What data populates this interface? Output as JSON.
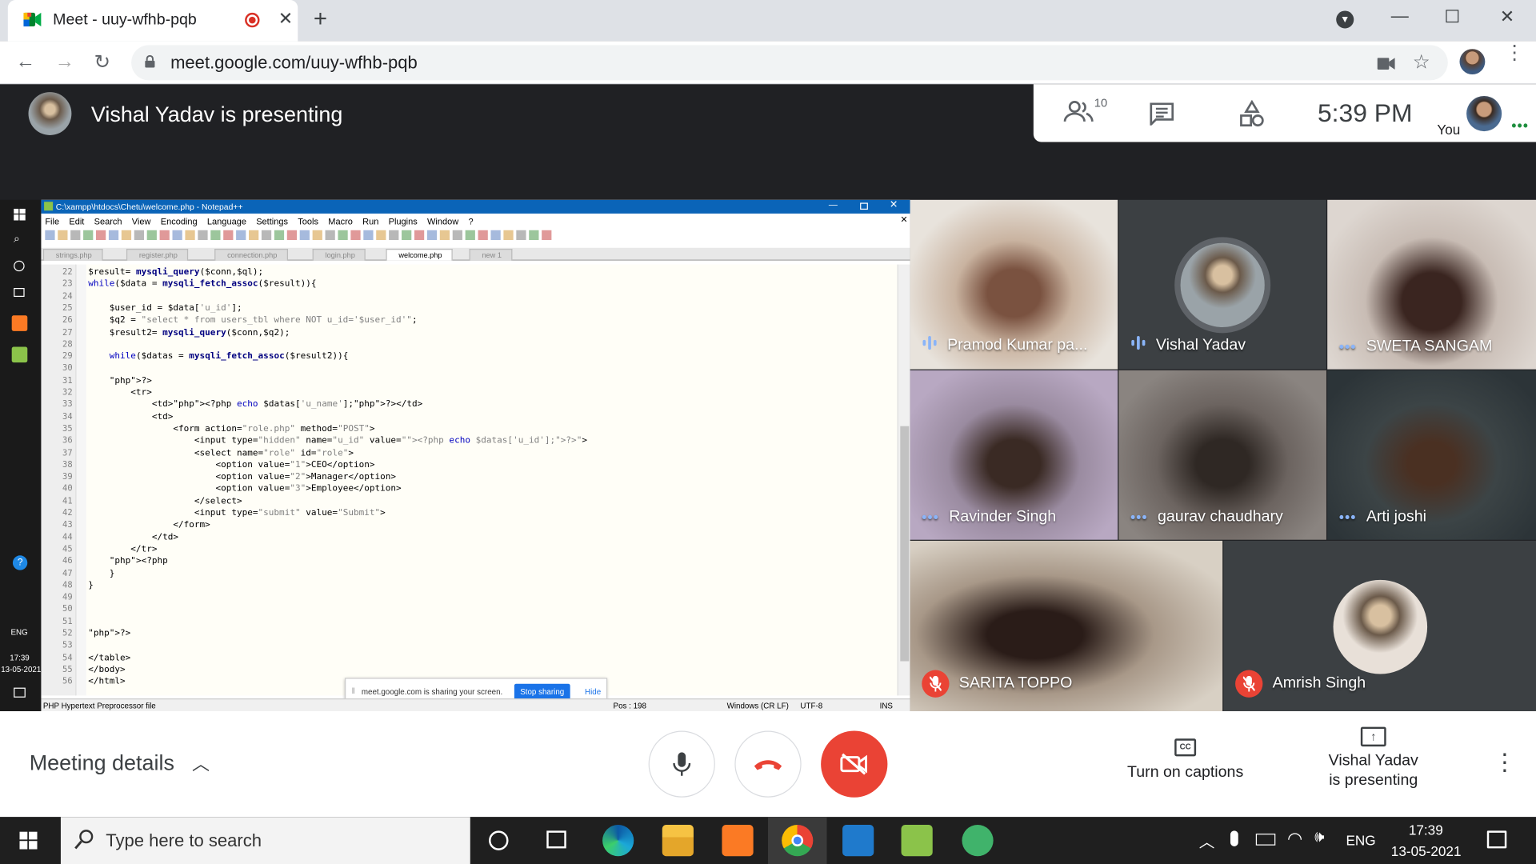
{
  "browser": {
    "tab_title": "Meet - uuy-wfhb-pqb",
    "url": "meet.google.com/uuy-wfhb-pqb"
  },
  "meet": {
    "presenting_label": "Vishal Yadav is presenting",
    "participants_count": "10",
    "time": "5:39 PM",
    "you_label": "You"
  },
  "notepad": {
    "title": "C:\\xampp\\htdocs\\Chetu\\welcome.php - Notepad++",
    "menu": [
      "File",
      "Edit",
      "Search",
      "View",
      "Encoding",
      "Language",
      "Settings",
      "Tools",
      "Macro",
      "Run",
      "Plugins",
      "Window",
      "?"
    ],
    "tabs": [
      "strings.php",
      "register.php",
      "connection.php",
      "login.php",
      "welcome.php",
      "new 1"
    ],
    "active_tab": "welcome.php",
    "lines": [
      {
        "n": "22",
        "t": "$result= mysqli_query($conn,$ql);"
      },
      {
        "n": "23",
        "t": "while($data = mysqli_fetch_assoc($result)){"
      },
      {
        "n": "24",
        "t": ""
      },
      {
        "n": "25",
        "t": "    $user_id = $data['u_id'];"
      },
      {
        "n": "26",
        "t": "    $q2 = \"select * from users_tbl where NOT u_id='$user_id'\";"
      },
      {
        "n": "27",
        "t": "    $result2= mysqli_query($conn,$q2);"
      },
      {
        "n": "28",
        "t": ""
      },
      {
        "n": "29",
        "t": "    while($datas = mysqli_fetch_assoc($result2)){"
      },
      {
        "n": "30",
        "t": ""
      },
      {
        "n": "31",
        "t": "    ?>"
      },
      {
        "n": "32",
        "t": "        <tr>"
      },
      {
        "n": "33",
        "t": "            <td><?php echo $datas['u_name'];?></td>"
      },
      {
        "n": "34",
        "t": "            <td>"
      },
      {
        "n": "35",
        "t": "                <form action=\"role.php\" method=\"POST\">"
      },
      {
        "n": "36",
        "t": "                    <input type=\"hidden\" name=\"u_id\" value=\"<?php echo $datas['u_id'];?>\">"
      },
      {
        "n": "37",
        "t": "                    <select name=\"role\" id=\"role\">"
      },
      {
        "n": "38",
        "t": "                        <option value=\"1\">CEO</option>"
      },
      {
        "n": "39",
        "t": "                        <option value=\"2\">Manager</option>"
      },
      {
        "n": "40",
        "t": "                        <option value=\"3\">Employee</option>"
      },
      {
        "n": "41",
        "t": "                    </select>"
      },
      {
        "n": "42",
        "t": "                    <input type=\"submit\" value=\"Submit\">"
      },
      {
        "n": "43",
        "t": "                </form>"
      },
      {
        "n": "44",
        "t": "            </td>"
      },
      {
        "n": "45",
        "t": "        </tr>"
      },
      {
        "n": "46",
        "t": "    <?php"
      },
      {
        "n": "47",
        "t": "    }"
      },
      {
        "n": "48",
        "t": "}"
      },
      {
        "n": "49",
        "t": ""
      },
      {
        "n": "50",
        "t": ""
      },
      {
        "n": "51",
        "t": ""
      },
      {
        "n": "52",
        "t": "?>"
      },
      {
        "n": "53",
        "t": ""
      },
      {
        "n": "54",
        "t": "</table>"
      },
      {
        "n": "55",
        "t": "</body>"
      },
      {
        "n": "56",
        "t": "</html>"
      }
    ],
    "status": {
      "filetype": "PHP Hypertext Preprocessor file",
      "pos": "Pos : 198",
      "eol": "Windows (CR LF)",
      "enc": "UTF-8",
      "ins": "INS"
    },
    "share_bar": {
      "text": "meet.google.com is sharing your screen.",
      "stop": "Stop sharing",
      "hide": "Hide"
    }
  },
  "remote_taskbar": {
    "lang": "ENG",
    "time": "17:39",
    "date": "13-05-2021"
  },
  "participants": [
    {
      "name": "Pramod Kumar pa...",
      "state": "speaking"
    },
    {
      "name": "Vishal Yadav",
      "state": "speaking"
    },
    {
      "name": "SWETA SANGAM",
      "state": "dots"
    },
    {
      "name": "Ravinder Singh",
      "state": "dots"
    },
    {
      "name": "gaurav chaudhary",
      "state": "dots"
    },
    {
      "name": "Arti joshi",
      "state": "dots"
    },
    {
      "name": "SARITA TOPPO",
      "state": "muted"
    },
    {
      "name": "Amrish Singh",
      "state": "muted"
    }
  ],
  "bottom": {
    "meeting_details": "Meeting details",
    "captions": "Turn on captions",
    "presenting_line1": "Vishal Yadav",
    "presenting_line2": "is presenting"
  },
  "taskbar": {
    "search_placeholder": "Type here to search",
    "lang": "ENG",
    "time": "17:39",
    "date": "13-05-2021"
  },
  "colors": {
    "meet_red": "#ea4335",
    "meet_blue": "#8ab4f8",
    "dark": "#202124"
  }
}
